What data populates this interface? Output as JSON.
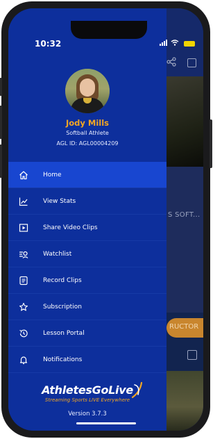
{
  "status": {
    "time": "10:32"
  },
  "profile": {
    "name": "Jody Mills",
    "role": "Softball Athlete",
    "agl_id": "AGL ID: AGL00004209"
  },
  "menu": [
    {
      "label": "Home",
      "icon": "home-icon",
      "active": true
    },
    {
      "label": "View Stats",
      "icon": "chart-icon",
      "active": false
    },
    {
      "label": "Share Video Clips",
      "icon": "play-icon",
      "active": false
    },
    {
      "label": "Watchlist",
      "icon": "watchlist-icon",
      "active": false
    },
    {
      "label": "Record Clips",
      "icon": "list-icon",
      "active": false
    },
    {
      "label": "Subscription",
      "icon": "star-icon",
      "active": false
    },
    {
      "label": "Lesson Portal",
      "icon": "history-icon",
      "active": false
    },
    {
      "label": "Notifications",
      "icon": "bell-icon",
      "active": false
    }
  ],
  "brand": {
    "logo_athletes": "Athletes",
    "logo_golive": "GoLive",
    "tagline": "Streaming Sports LIVE Everywhere",
    "version": "Version 3.7.3"
  },
  "background": {
    "partial_title": "S SOFT...",
    "partial_button": "RUCTOR"
  },
  "colors": {
    "drawer": "#0d2f9c",
    "active_item": "#1846d0",
    "accent": "#f2a623"
  }
}
